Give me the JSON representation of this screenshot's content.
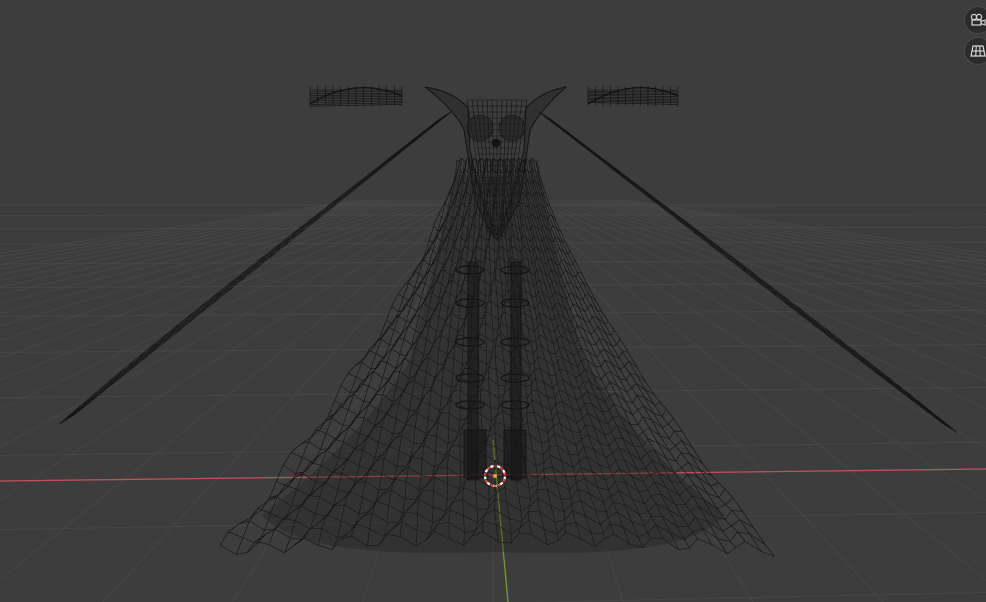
{
  "app": {
    "view": "3d-viewport",
    "shading": "wireframe"
  },
  "colors": {
    "background": "#3d3d3d",
    "grid": "#4f4f4f",
    "grid_major": "#595959",
    "x_axis": "#c0515a",
    "y_axis": "#7a9a2e",
    "wire": "#121212",
    "cursor_red": "#e8453c",
    "cursor_white": "#ffffff"
  },
  "overlay_buttons": [
    {
      "name": "toggle-camera-view",
      "icon": "camera-icon"
    },
    {
      "name": "toggle-perspective-ortho",
      "icon": "grid-icon"
    }
  ],
  "scene": {
    "object": "gown-mesh",
    "cursor": "3d-cursor"
  }
}
